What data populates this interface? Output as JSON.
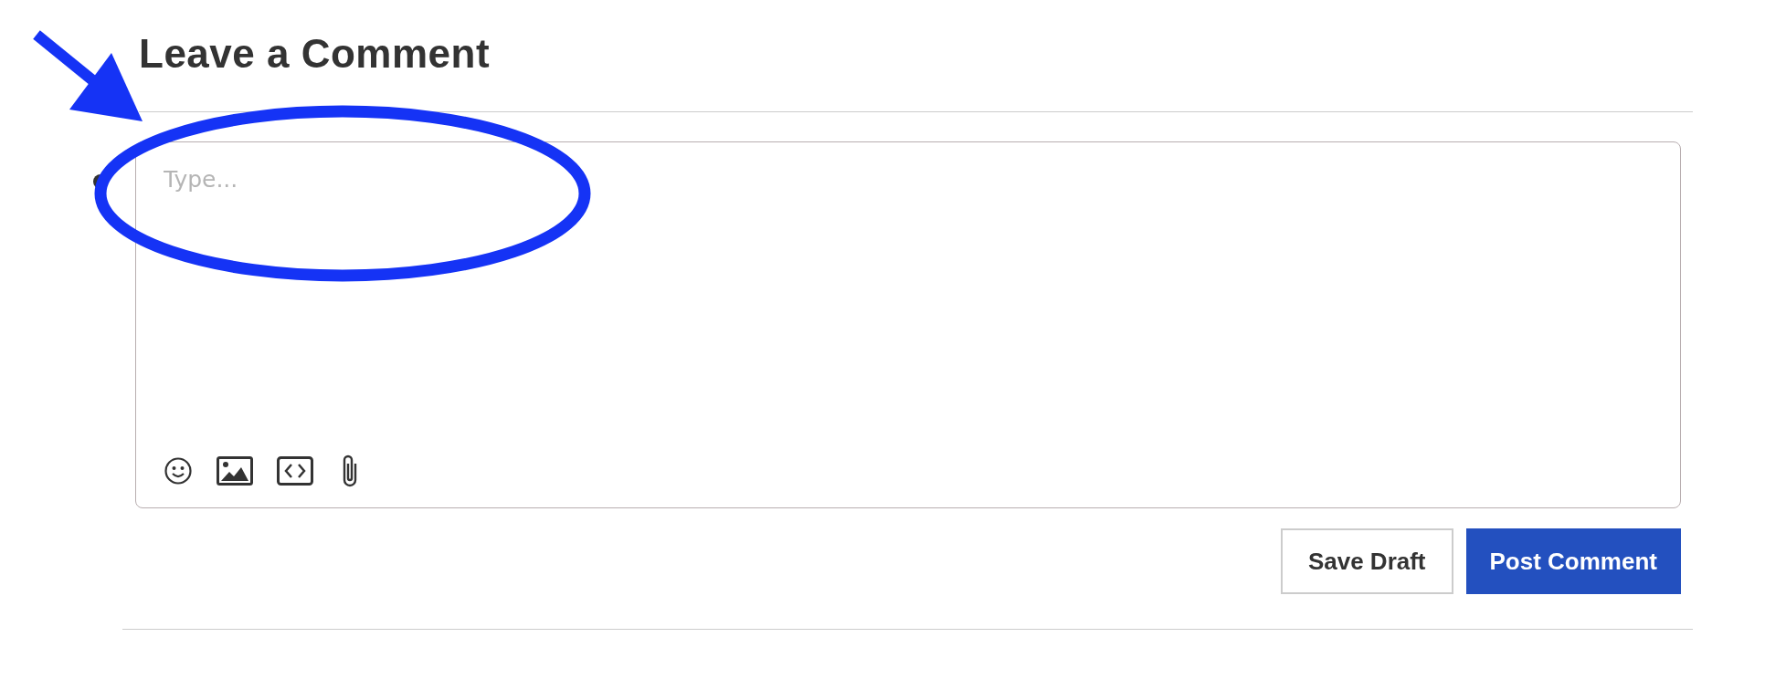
{
  "heading": "Leave a Comment",
  "comment_field": {
    "placeholder": "Type..."
  },
  "buttons": [
    {
      "label": "Save Draft",
      "kind": "secondary"
    },
    {
      "label": "Post Comment",
      "kind": "primary"
    }
  ]
}
